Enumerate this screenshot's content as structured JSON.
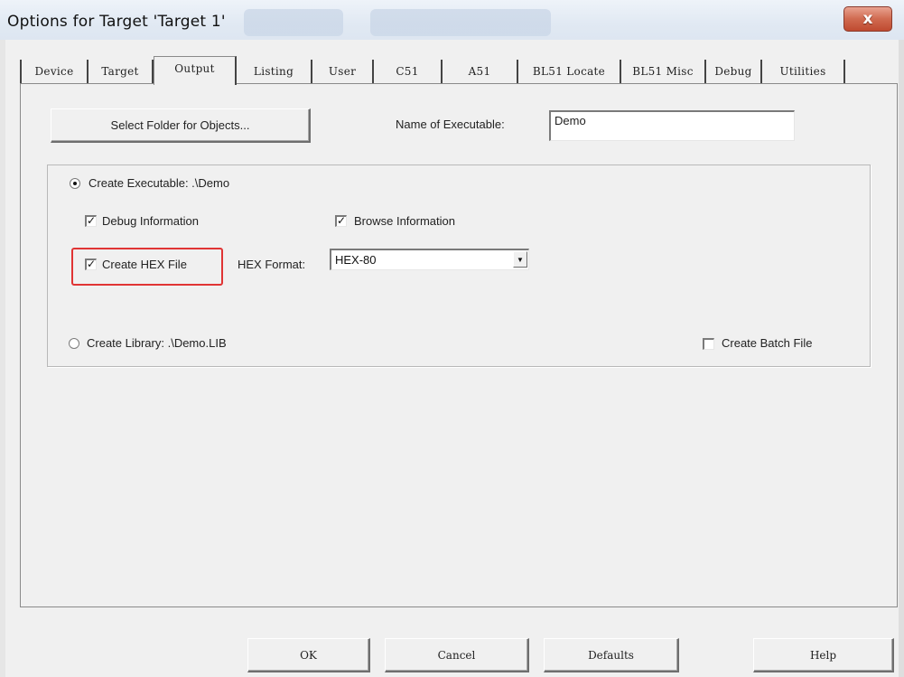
{
  "window": {
    "title": "Options for Target 'Target 1'",
    "close_label": "x"
  },
  "tabs": [
    {
      "label": "Device",
      "active": false
    },
    {
      "label": "Target",
      "active": false
    },
    {
      "label": "Output",
      "active": true
    },
    {
      "label": "Listing",
      "active": false
    },
    {
      "label": "User",
      "active": false
    },
    {
      "label": "C51",
      "active": false
    },
    {
      "label": "A51",
      "active": false
    },
    {
      "label": "BL51 Locate",
      "active": false
    },
    {
      "label": "BL51 Misc",
      "active": false
    },
    {
      "label": "Debug",
      "active": false
    },
    {
      "label": "Utilities",
      "active": false
    }
  ],
  "output": {
    "select_folder_label": "Select Folder for Objects...",
    "name_exec_label": "Name of Executable:",
    "name_exec_value": "Demo",
    "create_exec_label": "Create Executable:  .\\Demo",
    "create_exec_selected": true,
    "debug_info_label": "Debug Information",
    "debug_info_checked": true,
    "browse_info_label": "Browse Information",
    "browse_info_checked": true,
    "create_hex_label": "Create HEX File",
    "create_hex_checked": true,
    "hex_format_label": "HEX Format:",
    "hex_format_value": "HEX-80",
    "create_lib_label": "Create Library:  .\\Demo.LIB",
    "create_lib_selected": false,
    "create_batch_label": "Create Batch File",
    "create_batch_checked": false
  },
  "footer": {
    "ok_label": "OK",
    "cancel_label": "Cancel",
    "defaults_label": "Defaults",
    "help_label": "Help"
  },
  "colors": {
    "highlight_box": "#e03434",
    "dialog_bg": "#f0f0f0",
    "close_button": "#c8553a"
  },
  "icons": {
    "close": "close-icon",
    "check": "checkmark-icon",
    "dropdown": "chevron-down-icon"
  }
}
